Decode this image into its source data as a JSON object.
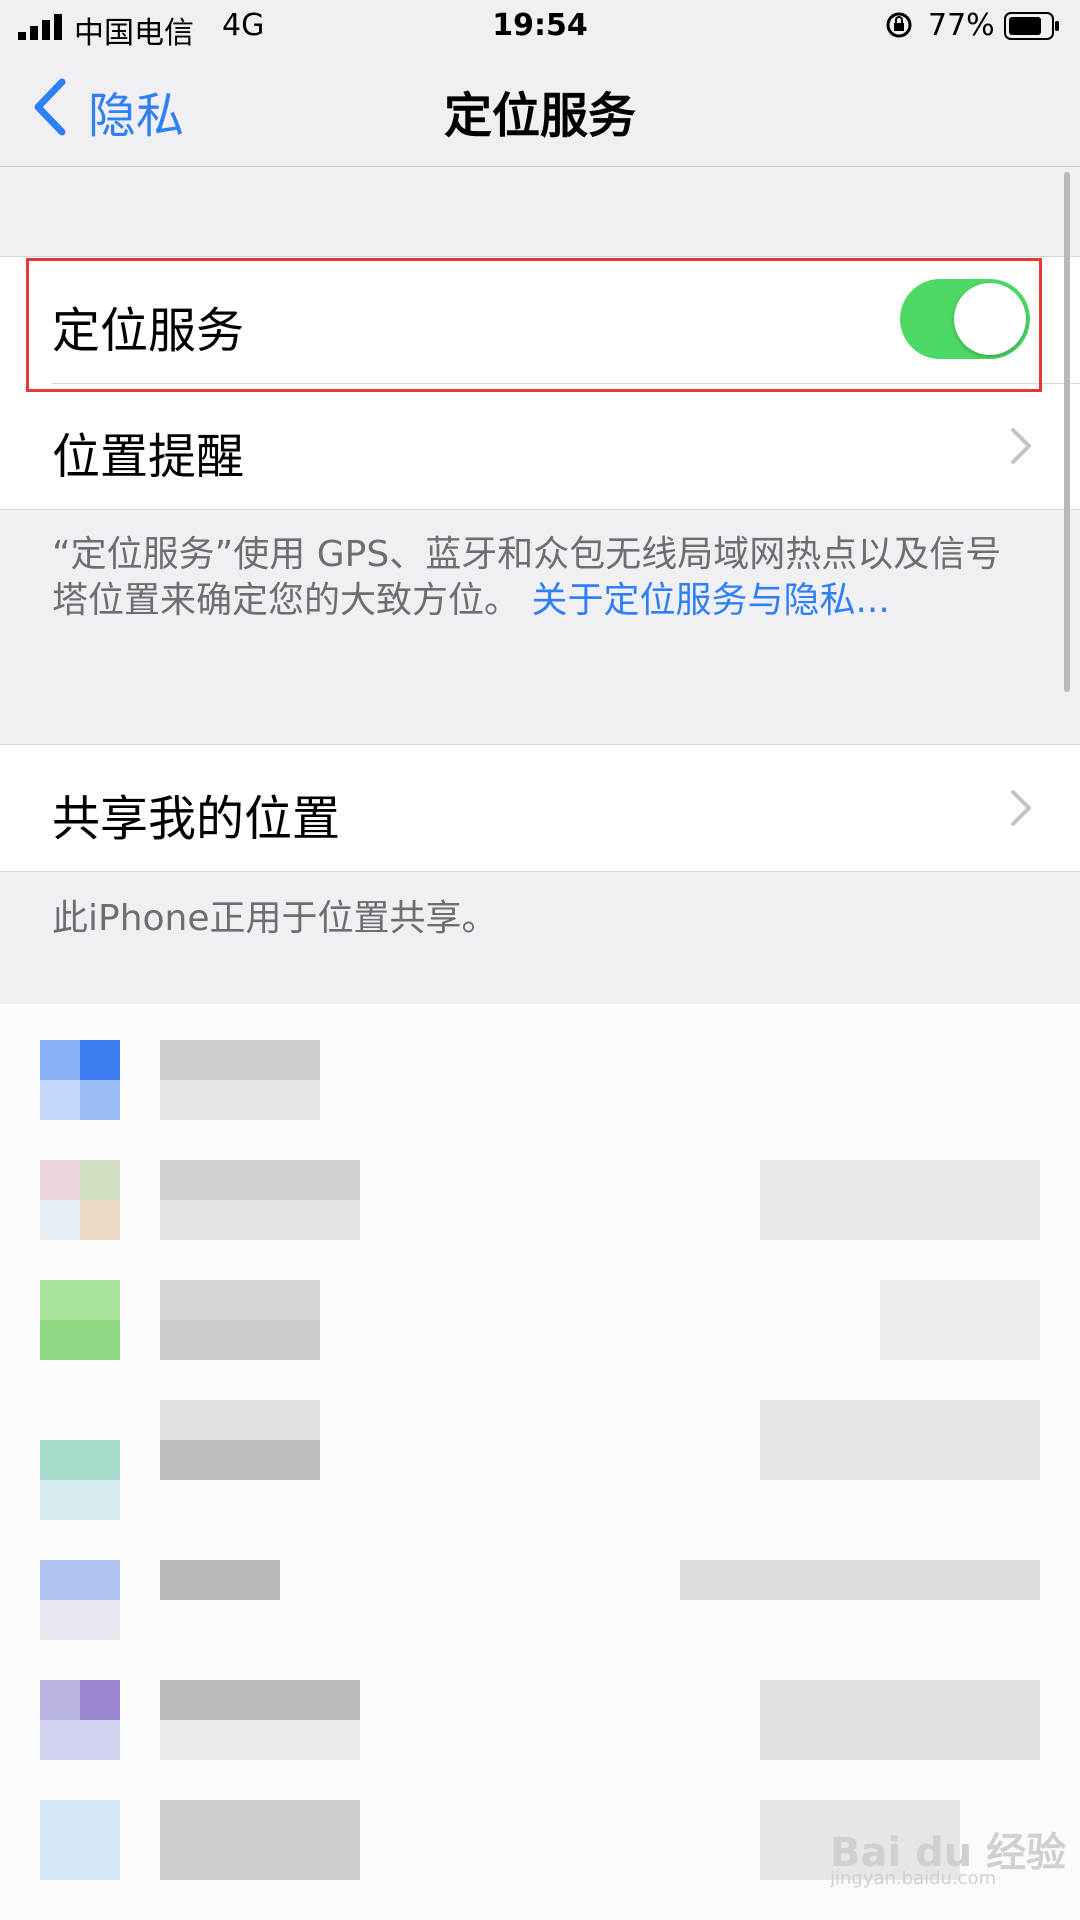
{
  "status_bar": {
    "carrier": "中国电信",
    "network": "4G",
    "time": "19:54",
    "battery": "77%"
  },
  "nav": {
    "back_label": "隐私",
    "title": "定位服务"
  },
  "location_services": {
    "label": "定位服务",
    "enabled": true
  },
  "location_alerts": {
    "label": "位置提醒"
  },
  "footer1": {
    "text": "“定位服务”使用 GPS、蓝牙和众包无线局域网热点以及信号塔位置来确定您的大致方位。",
    "link": "关于定位服务与隐私..."
  },
  "share_location": {
    "label": "共享我的位置"
  },
  "footer2": {
    "text": "此iPhone正用于位置共享。"
  },
  "watermark": {
    "brand": "Bai du 经验",
    "url": "jingyan.baidu.com"
  },
  "colors": {
    "accent": "#2f7ff7",
    "toggle_on": "#4cd964",
    "highlight": "#e53935"
  }
}
